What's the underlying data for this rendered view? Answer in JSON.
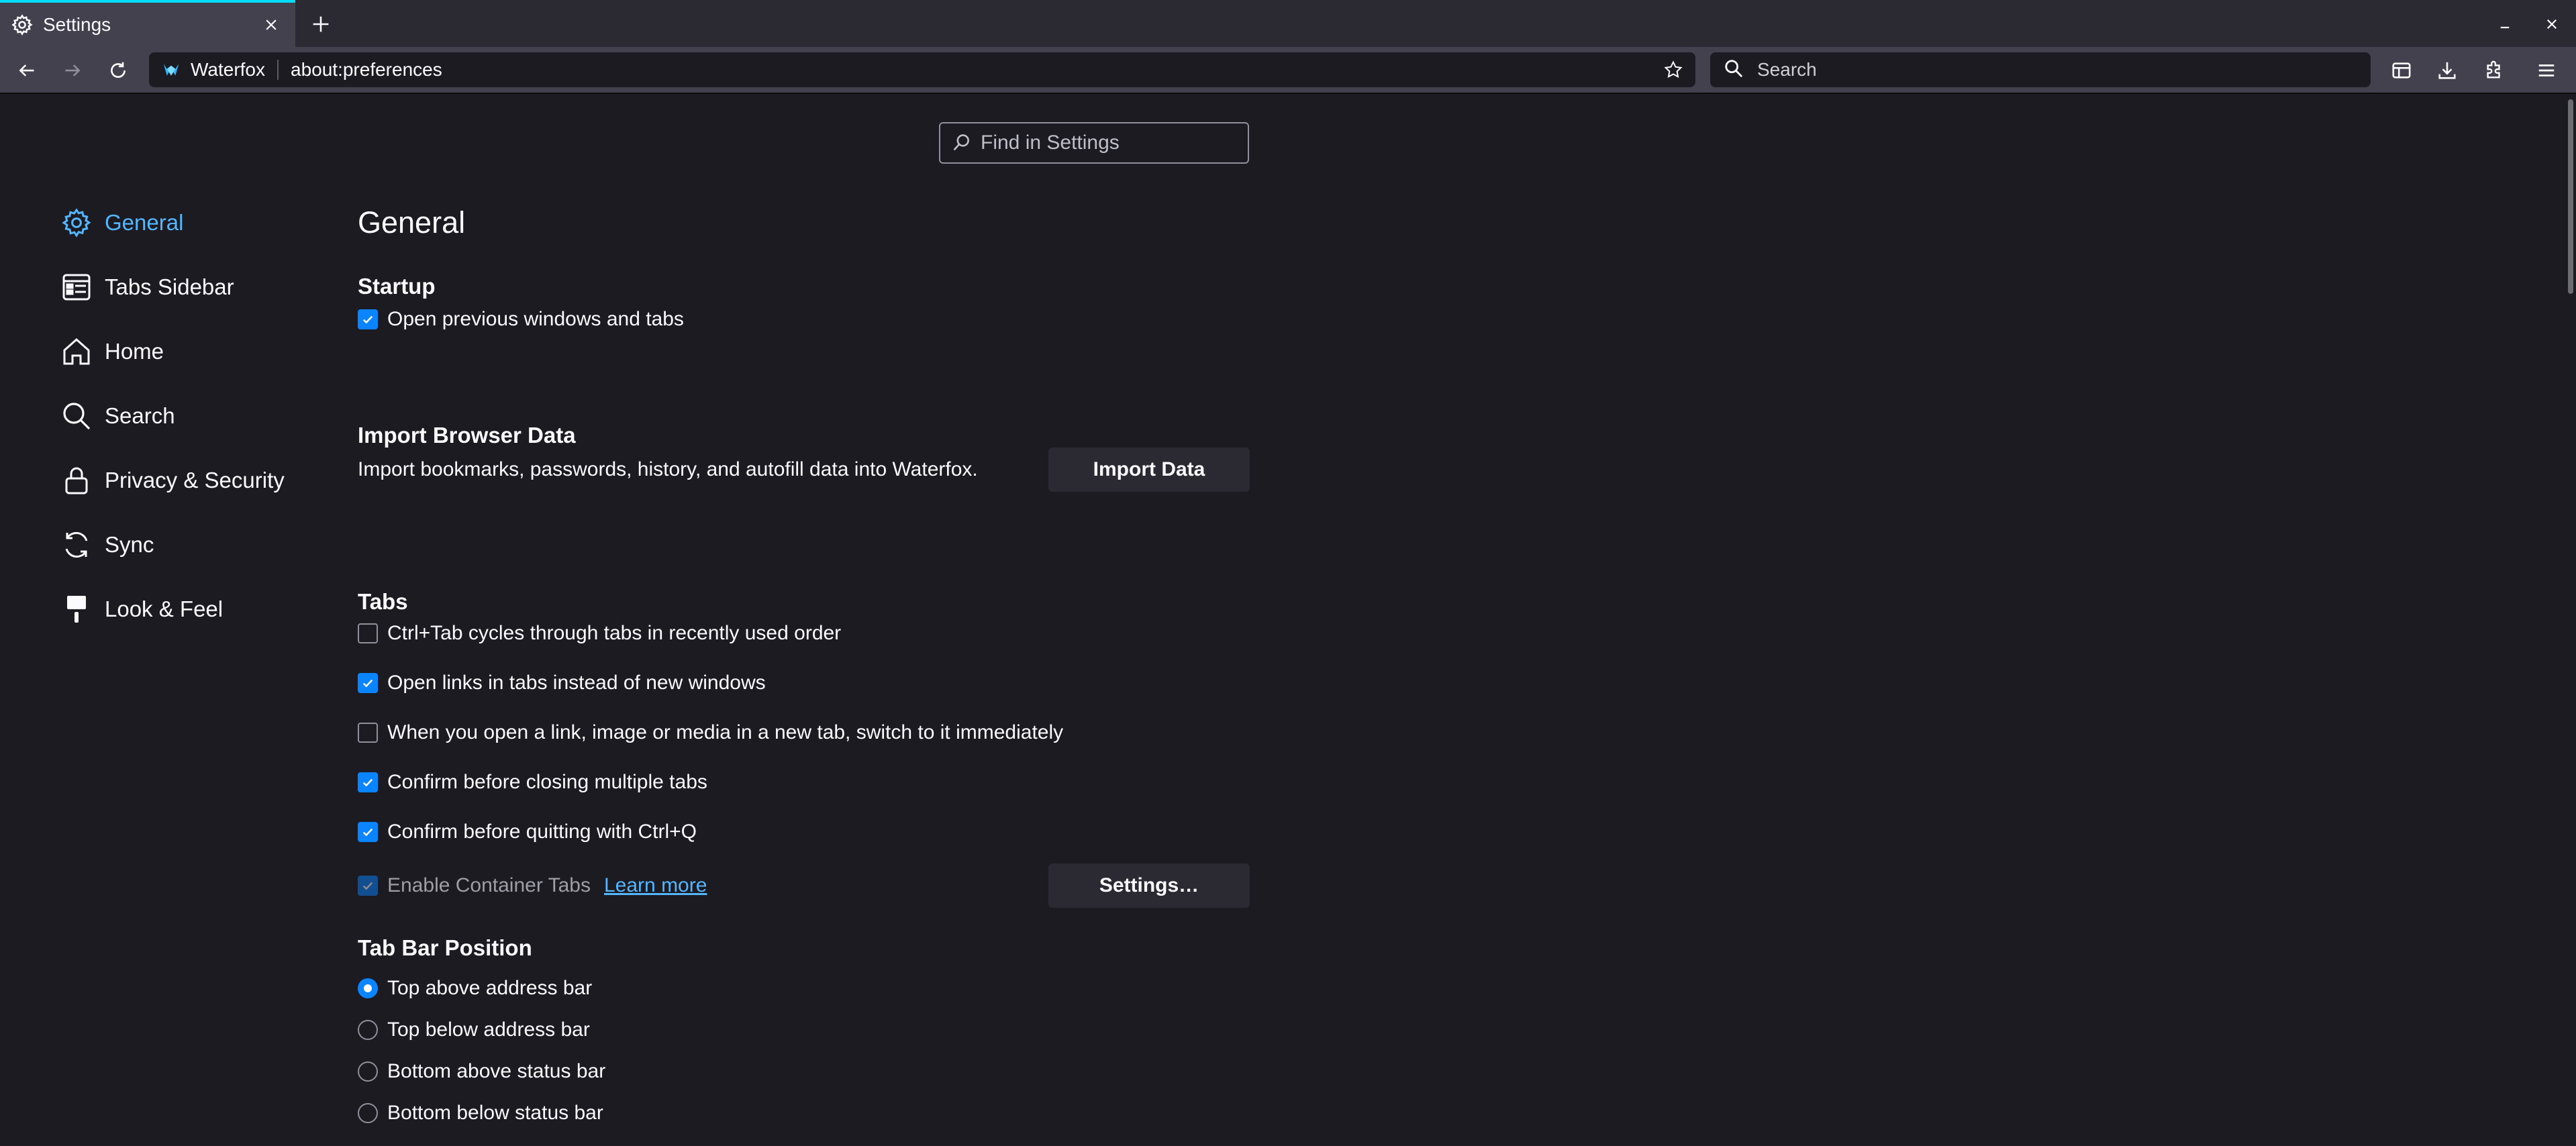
{
  "tab": {
    "title": "Settings"
  },
  "urlbar": {
    "identity_label": "Waterfox",
    "url": "about:preferences"
  },
  "searchbar": {
    "placeholder": "Search"
  },
  "find": {
    "placeholder": "Find in Settings"
  },
  "categories": [
    {
      "label": "General",
      "icon": "gear-icon",
      "selected": true
    },
    {
      "label": "Tabs Sidebar",
      "icon": "tabs-sidebar-icon",
      "selected": false
    },
    {
      "label": "Home",
      "icon": "home-icon",
      "selected": false
    },
    {
      "label": "Search",
      "icon": "search-icon",
      "selected": false
    },
    {
      "label": "Privacy & Security",
      "icon": "lock-icon",
      "selected": false
    },
    {
      "label": "Sync",
      "icon": "sync-icon",
      "selected": false
    },
    {
      "label": "Look & Feel",
      "icon": "paintbrush-icon",
      "selected": false
    }
  ],
  "main": {
    "title": "General",
    "startup": {
      "heading": "Startup",
      "restore_session": {
        "label": "Open previous windows and tabs",
        "checked": true
      }
    },
    "import": {
      "heading": "Import Browser Data",
      "description": "Import bookmarks, passwords, history, and autofill data into Waterfox.",
      "button": "Import Data"
    },
    "tabs": {
      "heading": "Tabs",
      "options": [
        {
          "label": "Ctrl+Tab cycles through tabs in recently used order",
          "checked": false
        },
        {
          "label": "Open links in tabs instead of new windows",
          "checked": true
        },
        {
          "label": "When you open a link, image or media in a new tab, switch to it immediately",
          "checked": false
        },
        {
          "label": "Confirm before closing multiple tabs",
          "checked": true
        },
        {
          "label": "Confirm before quitting with Ctrl+Q",
          "checked": true
        }
      ],
      "container": {
        "label": "Enable Container Tabs",
        "checked": true,
        "disabled": true,
        "link": "Learn more",
        "button": "Settings…"
      }
    },
    "tab_bar_position": {
      "heading": "Tab Bar Position",
      "options": [
        {
          "label": "Top above address bar",
          "selected": true
        },
        {
          "label": "Top below address bar",
          "selected": false
        },
        {
          "label": "Bottom above status bar",
          "selected": false
        },
        {
          "label": "Bottom below status bar",
          "selected": false
        }
      ]
    }
  },
  "colors": {
    "accent": "#0a84ff",
    "link": "#54b6ff",
    "background": "#1c1b22",
    "toolbar": "#42414d"
  }
}
